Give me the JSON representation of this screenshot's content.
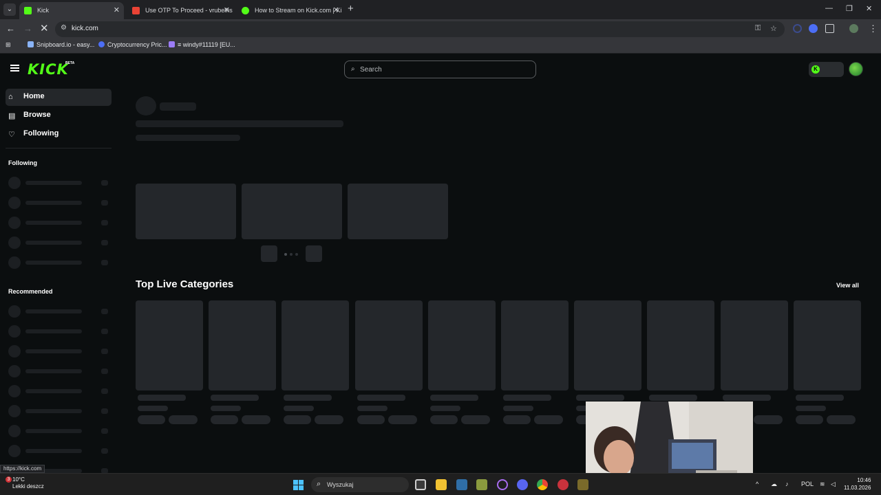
{
  "browser": {
    "tabs": [
      {
        "title": "Kick",
        "favicon_color": "#53fc18"
      },
      {
        "title": "Use OTP To Proceed - vrubelhs",
        "favicon_color": "#ea4335"
      },
      {
        "title": "How to Stream on Kick.com | Ki",
        "favicon_color": "#53fc18"
      }
    ],
    "new_tab": "+",
    "url": "kick.com",
    "bookmarks": [
      {
        "label": "Snipboard.io - easy...",
        "color": "#8ab4f8"
      },
      {
        "label": "Cryptocurrency Pric...",
        "color": "#4c6ef5"
      },
      {
        "label": "≡ windy#11119 [EU...",
        "color": "#9b7cf6"
      }
    ],
    "status_url": "https://kick.com"
  },
  "kick": {
    "logo": "KICK",
    "logo_badge": "BETA",
    "search_placeholder": "Search",
    "brand_color": "#53fc18",
    "nav": [
      {
        "label": "Home",
        "icon": "home-icon",
        "active": true
      },
      {
        "label": "Browse",
        "icon": "browse-icon",
        "active": false
      },
      {
        "label": "Following",
        "icon": "heart-icon",
        "active": false
      }
    ],
    "following_heading": "Following",
    "recommended_heading": "Recommended",
    "top_categories_title": "Top Live Categories",
    "view_all": "View all"
  },
  "taskbar": {
    "weather_temp": "10°C",
    "weather_desc": "Lekki deszcz",
    "weather_badge": "3",
    "search_label": "Wyszukaj",
    "language": "POL",
    "time": "10:46",
    "date": "11.03.2026"
  }
}
